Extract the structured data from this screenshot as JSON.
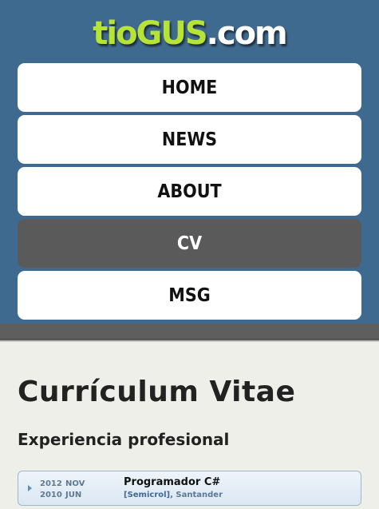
{
  "logo": {
    "part1": "tioGUS",
    "part2": ".com",
    "color_green": "#b6e335",
    "color_white": "#ffffff"
  },
  "nav": {
    "items": [
      {
        "label": "HOME",
        "active": false
      },
      {
        "label": "NEWS",
        "active": false
      },
      {
        "label": "ABOUT",
        "active": false
      },
      {
        "label": "CV",
        "active": true
      },
      {
        "label": "MSG",
        "active": false
      }
    ]
  },
  "main": {
    "title": "Currículum Vitae",
    "section_title": "Experiencia profesional",
    "entries": [
      {
        "end_year": "2012",
        "end_month": "NOV",
        "start_year": "2010",
        "start_month": "JUN",
        "role": "Programador C#",
        "company": "[Semicrol]",
        "location": ", Santander"
      }
    ]
  },
  "colors": {
    "header_bg": "#3f6a8f",
    "page_bg": "#efefea",
    "nav_active_bg": "#5a5a5a",
    "entry_border": "#9bb8d0"
  }
}
